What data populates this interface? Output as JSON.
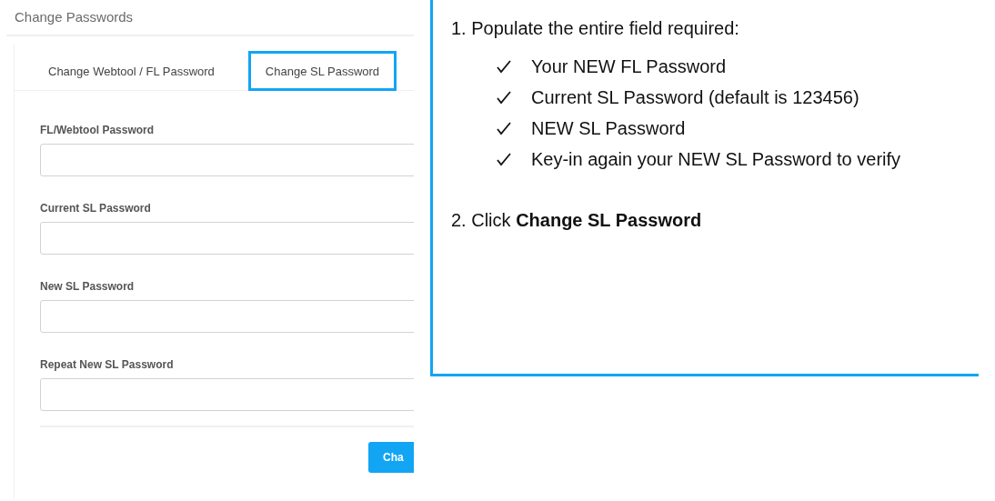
{
  "page": {
    "title": "Change Passwords"
  },
  "tabs": [
    {
      "label": "Change Webtool / FL Password",
      "selected": false
    },
    {
      "label": "Change SL Password",
      "selected": true
    }
  ],
  "fields": [
    {
      "label": "FL/Webtool Password"
    },
    {
      "label": "Current SL Password"
    },
    {
      "label": "New SL Password"
    },
    {
      "label": "Repeat New SL Password"
    }
  ],
  "submit_button": {
    "label": "Cha"
  },
  "callout": {
    "step_1": "1. Populate the entire field required:",
    "checklist": [
      "Your NEW FL Password",
      "Current SL Password (default is 123456)",
      "NEW SL Password",
      "Key-in again your NEW SL Password to verify"
    ],
    "step_2": "2. Click **Change SL Password**"
  }
}
